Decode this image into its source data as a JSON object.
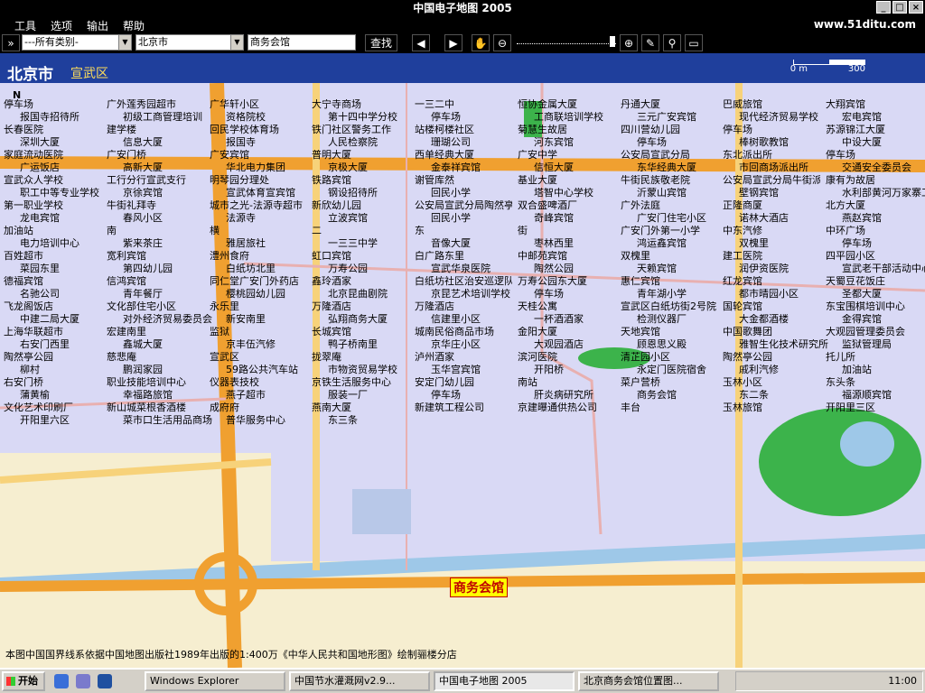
{
  "window": {
    "title": "中国电子地图 2005"
  },
  "menu": {
    "items": [
      "工具",
      "选项",
      "输出",
      "帮助"
    ],
    "site": "www.51ditu.com"
  },
  "toolbar": {
    "category_value": "---所有类别-",
    "city_value": "北京市",
    "search_value": "商务会馆",
    "search_label": "查找"
  },
  "header": {
    "city": "北京市",
    "district": "宣武区"
  },
  "scale": {
    "zero": "0  m",
    "max": "300"
  },
  "map": {
    "compass": "N",
    "highlight_label": "商务会馆",
    "labels": [
      "停车场",
      "广外莲秀园超市",
      "广华轩小区",
      "大宁寺商场",
      "一三二中",
      "恒协金属大厦",
      "丹通大厦",
      "巴威旅馆",
      "大翔宾馆",
      "报国寺招待所",
      "初级工商管理培训",
      "资格院校",
      "第十四中学分校",
      "停车场",
      "工商联培训学校",
      "三元广安宾馆",
      "现代经济贸易学校",
      "宏电宾馆",
      "长春医院",
      "建学楼",
      "回民学校体育场",
      "铁门社区警务工作",
      "站楼柯楼社区",
      "菊慧生故居",
      "四川营幼儿园",
      "停车场",
      "苏源锦江大厦",
      "深圳大厦",
      "信息大厦",
      "报国寺",
      "人民检察院",
      "珊瑚公司",
      "河东宾馆",
      "停车场",
      "棒树歌教馆",
      "中设大厦",
      "家庭流动医院",
      "广安门桥",
      "广安宾馆",
      "普明大厦",
      "西单经典大厦",
      "广安中学",
      "公安局宣武分局",
      "东北派出所",
      "停车场",
      "广运饭店",
      "高新大厦",
      "华北电力集团",
      "京极大厦",
      "金泰祥宾馆",
      "信恒大厦",
      "东华经典大厦",
      "市回商场派出所",
      "交通安全委员会",
      "宣武众人学校",
      "工行分行宣武支行",
      "明琴园分理处",
      "铁路宾馆",
      "谢管库然",
      "基业大厦",
      "牛街民族敬老院",
      "公安局宣武分局牛街派出所",
      "康有为故居",
      "职工中等专业学校",
      "京徐宾馆",
      "宣武体育宣宾馆",
      "钢设招待所",
      "回民小学",
      "塔智中心学校",
      "沂蒙山宾馆",
      "壁钢宾馆",
      "水利部黄河万家寨工程开发公司",
      "第一职业学校",
      "牛街礼拜寺",
      "城市之光-法源寺超市",
      "新欣幼儿园",
      "公安局宣武分局陶然亭派出所",
      "双合盛啤酒厂",
      "广外法庭",
      "正隆商厦",
      "北方大厦",
      "龙电宾馆",
      "春风小区",
      "法源寺",
      "立波宾馆",
      "回民小学",
      "奇峰宾馆",
      "广安门住宅小区",
      "诺林大酒店",
      "燕赵宾馆",
      "加油站",
      "南",
      "横",
      "二",
      "东",
      "街",
      "广安门外第一小学",
      "中东汽修",
      "中环广场",
      "电力培训中心",
      "紫来茶庄",
      "雅居旅社",
      "一三三中学",
      "音像大厦",
      "枣林西里",
      "鸿运鑫宾馆",
      "双槐里",
      "停车场",
      "百姓超市",
      "宽利宾馆",
      "澧州食府",
      "虹口宾馆",
      "白广路东里",
      "中邮苑宾馆",
      "双槐里",
      "建工医院",
      "四平园小区",
      "菜园东里",
      "第四幼儿园",
      "白纸坊北里",
      "万寿公园",
      "宣武华泉医院",
      "陶然公园",
      "天赖宾馆",
      "润伊资医院",
      "宣武老干部活动中心",
      "德福宾馆",
      "信鸿宾馆",
      "同仁堂广安门外药店",
      "鑫玲酒家",
      "白纸坊社区治安巡逻队",
      "万寿公园东大厦",
      "惠仁宾馆",
      "红龙宾馆",
      "天蜀豆花饭庄",
      "名驰公司",
      "青年餐厅",
      "樱桃园幼儿园",
      "北京昆曲剧院",
      "京昆艺术培训学校",
      "停车场",
      "青年湖小学",
      "都市晴园小区",
      "圣都大厦",
      "飞龙阁饭店",
      "文化部住宅小区",
      "永乐里",
      "万隆酒店",
      "万隆酒店",
      "天桂公寓",
      "宣武区白纸坊街2号院",
      "国轮宾馆",
      "东宝围棋培训中心",
      "中建二局大厦",
      "对外经济贸易委员会",
      "新安南里",
      "弘翔商务大厦",
      "信建里小区",
      "一杯酒酒家",
      "检测仪器厂",
      "大金都酒楼",
      "金得宾馆",
      "上海华联超市",
      "宏建南里",
      "监狱",
      "长城宾馆",
      "城南民俗商品市场",
      "金阳大厦",
      "天地宾馆",
      "中国歌舞团",
      "大观园管理委员会",
      "右安门西里",
      "鑫城大厦",
      "京丰伍汽修",
      "鸭子桥南里",
      "京华庄小区",
      "大观园酒店",
      "顾恩思义殿",
      "雅智生化技术研究所",
      "监狱管理局",
      "陶然亭公园",
      "慈悲庵",
      "宣武区",
      "拢翠庵",
      "泸州酒家",
      "滨河医院",
      "清芷园小区",
      "陶然亭公园",
      "托儿所",
      "柳村",
      "鹏润家园",
      "59路公共汽车站",
      "市物资贸易学校",
      "玉华宫宾馆",
      "开阳桥",
      "永定门医院宿舍",
      "戚利汽修",
      "加油站",
      "右安门桥",
      "职业技能培训中心",
      "仪器表技校",
      "京铁生活服务中心",
      "安定门幼儿园",
      "南站",
      "菜户营桥",
      "玉林小区",
      "东头条",
      "蒲黄榆",
      "幸福路旅馆",
      "燕子超市",
      "服装一厂",
      "停车场",
      "肝炎病研究所",
      "商务会馆",
      "东二条",
      "福源顺宾馆",
      "文化艺术印刷厂",
      "新山城菜根香酒楼",
      "成府府",
      "燕南大厦",
      "新建筑工程公司",
      "京建曝通供热公司",
      "丰台",
      "玉林旅馆",
      "开阳里三区",
      "开阳里六区",
      "菜市口生活用品商场",
      "普华服务中心",
      "东三条"
    ],
    "copyright": "本图中国国界线系依据中国地图出版社1989年出版的1:400万《中华人民共和国地形图》绘制骊楼分店"
  },
  "taskbar": {
    "start": "开始",
    "tasks": [
      "Windows Explorer",
      "中国节水灌溉网v2.9...",
      "中国电子地图 2005",
      "北京商务会馆位置图..."
    ],
    "clock": "11:00"
  },
  "colors": {
    "map_bg": "#d9d9f5",
    "road_orange": "#f0a030",
    "road_yellow": "#f7d27a",
    "river": "#9ec8e8",
    "park": "#3cb34b",
    "header": "#1f3f9c"
  }
}
